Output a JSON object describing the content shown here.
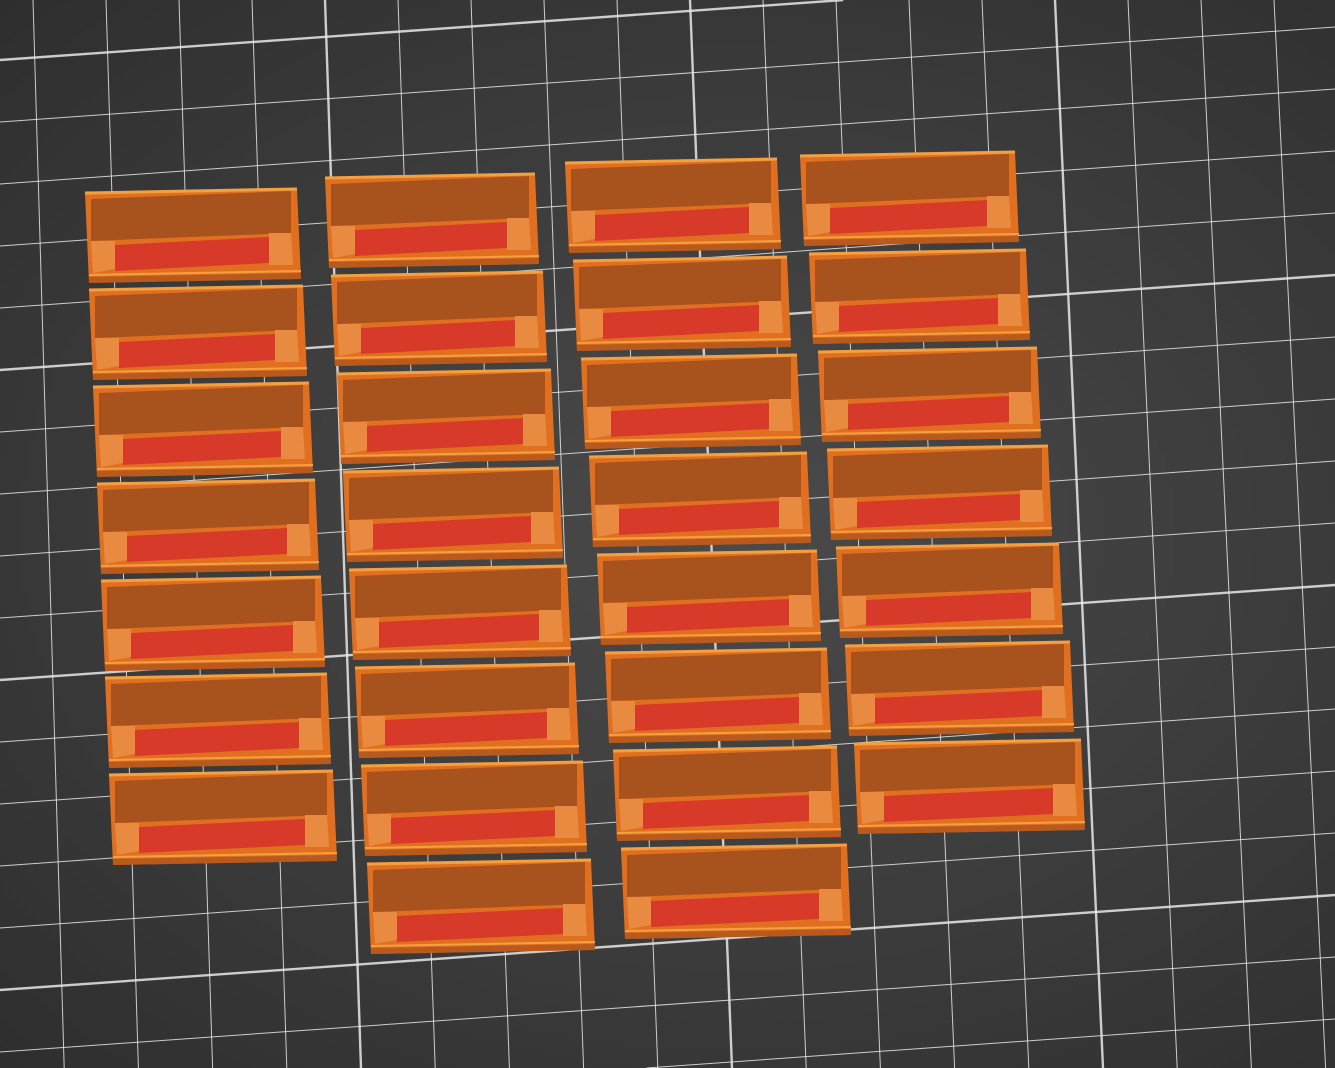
{
  "scene": {
    "view": "slicer-3d-preview",
    "columns": [
      {
        "box_count": 7
      },
      {
        "box_count": 8
      },
      {
        "box_count": 8
      },
      {
        "box_count": 7
      }
    ]
  },
  "colors": {
    "bed_background": "#3c3c3c",
    "grid_line": "#e8e8e8",
    "wall": "#e07020",
    "wall_dark": "#9c4a1c",
    "back_wall": "#a8521e",
    "floor": "#d83a2a",
    "rim": "#f5a040"
  }
}
